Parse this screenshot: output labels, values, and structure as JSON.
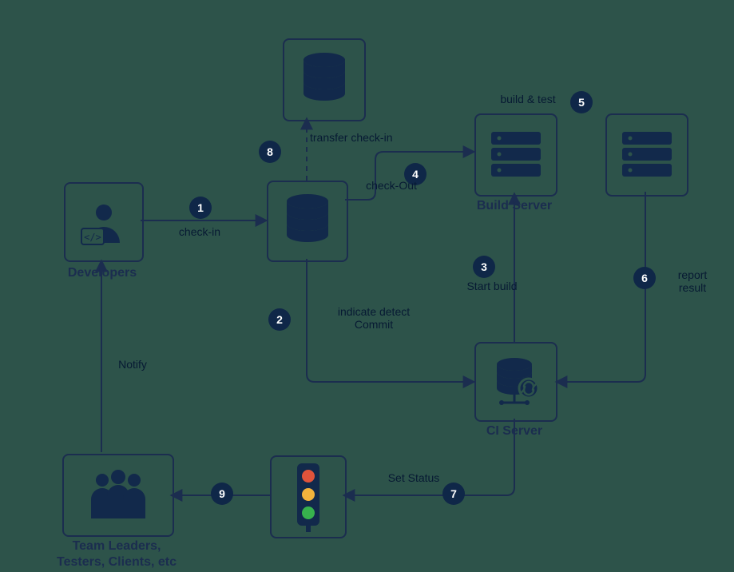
{
  "nodes": {
    "developers": {
      "label": "Developers"
    },
    "team": {
      "label": "Team Leaders,\nTesters, Clients, etc"
    },
    "build": {
      "label": "Build Server"
    },
    "ci": {
      "label": "CI Server"
    }
  },
  "steps": {
    "s1": {
      "num": "1",
      "label": "check-in"
    },
    "s2": {
      "num": "2",
      "label": "indicate detect\nCommit"
    },
    "s3": {
      "num": "3",
      "label": "Start build"
    },
    "s4": {
      "num": "4",
      "label": "check-Out"
    },
    "s5": {
      "num": "5",
      "label": "build & test"
    },
    "s6": {
      "num": "6",
      "label": "report\nresult"
    },
    "s7": {
      "num": "7",
      "label": "Set Status"
    },
    "s8": {
      "num": "8",
      "label": "transfer check-in"
    },
    "s9": {
      "num": "9",
      "label": ""
    },
    "notify": {
      "label": "Notify"
    }
  }
}
